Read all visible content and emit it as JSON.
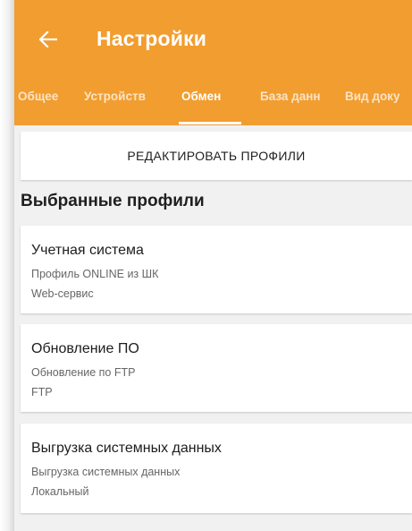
{
  "app_bar": {
    "title": "Настройки",
    "back_icon": "arrow-left-icon",
    "color": "#f29d2f"
  },
  "tabs": [
    {
      "label": "Общее",
      "active": false
    },
    {
      "label": "Устройств",
      "active": false
    },
    {
      "label": "Обмен",
      "active": true
    },
    {
      "label": "База данн",
      "active": false
    },
    {
      "label": "Вид доку",
      "active": false
    }
  ],
  "edit_profiles": {
    "label": "РЕДАКТИРОВАТЬ ПРОФИЛИ"
  },
  "selected_profiles": {
    "heading": "Выбранные профили",
    "items": [
      {
        "title": "Учетная система",
        "subtitle": "Профиль ONLINE из ШК",
        "detail": "Web-сервис"
      },
      {
        "title": "Обновление ПО",
        "subtitle": "Обновление по FTP",
        "detail": "FTP"
      },
      {
        "title": "Выгрузка системных данных",
        "subtitle": "Выгрузка системных данных",
        "detail": "Локальный"
      }
    ]
  }
}
